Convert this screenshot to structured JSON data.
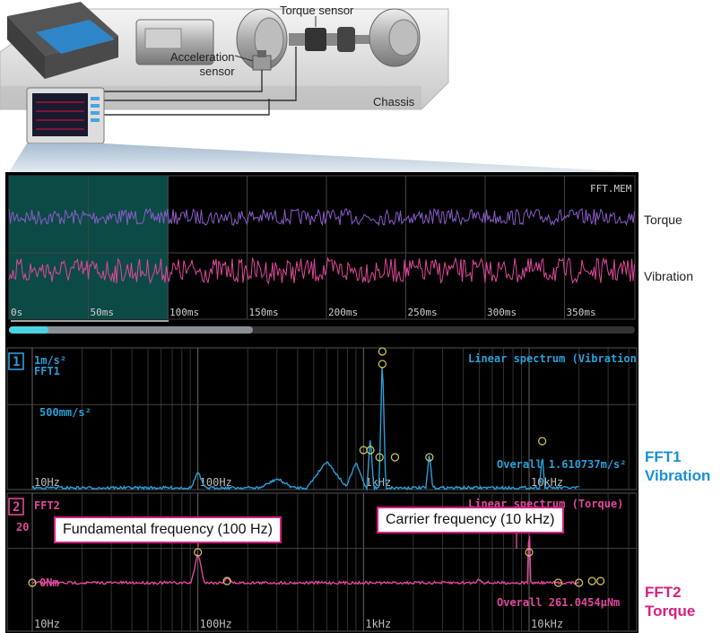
{
  "diagram": {
    "torque_sensor_label": "Torque sensor",
    "acceleration_sensor_label": "Acceleration\nsensor",
    "chassis_label": "Chassis"
  },
  "screen": {
    "mode_label": "FFT.MEM",
    "time_ticks": [
      "0s",
      "50ms",
      "100ms",
      "150ms",
      "200ms",
      "250ms",
      "300ms",
      "350ms"
    ],
    "waveforms": [
      {
        "name": "Torque",
        "color": "#8a5cc9"
      },
      {
        "name": "Vibration",
        "color": "#e0489c"
      }
    ],
    "fft1": {
      "number": "1",
      "y_top": "1m/s²",
      "name": "FFT1",
      "title": "Linear spectrum (Vibration)",
      "y_mid": "500mm/s²",
      "overall": "Overall  1.610737m/s²",
      "x_ticks": [
        "10Hz",
        "100Hz",
        "1kHz",
        "10kHz"
      ],
      "color": "#2a9fd8"
    },
    "fft2": {
      "number": "2",
      "name": "FFT2",
      "title": "Linear spectrum (Torque)",
      "y_top": "20",
      "y_zero": "0Nm",
      "overall": "Overall  261.0454µNm",
      "x_ticks": [
        "10Hz",
        "100Hz",
        "1kHz",
        "10kHz"
      ],
      "color": "#e0489c"
    }
  },
  "side_labels": {
    "torque": "Torque",
    "vibration": "Vibration",
    "fft1_line1": "FFT1",
    "fft1_line2": "Vibration",
    "fft2_line1": "FFT2",
    "fft2_line2": "Torque"
  },
  "callouts": {
    "fundamental": "Fundamental frequency (100 Hz)",
    "carrier": "Carrier frequency (10 kHz)"
  }
}
